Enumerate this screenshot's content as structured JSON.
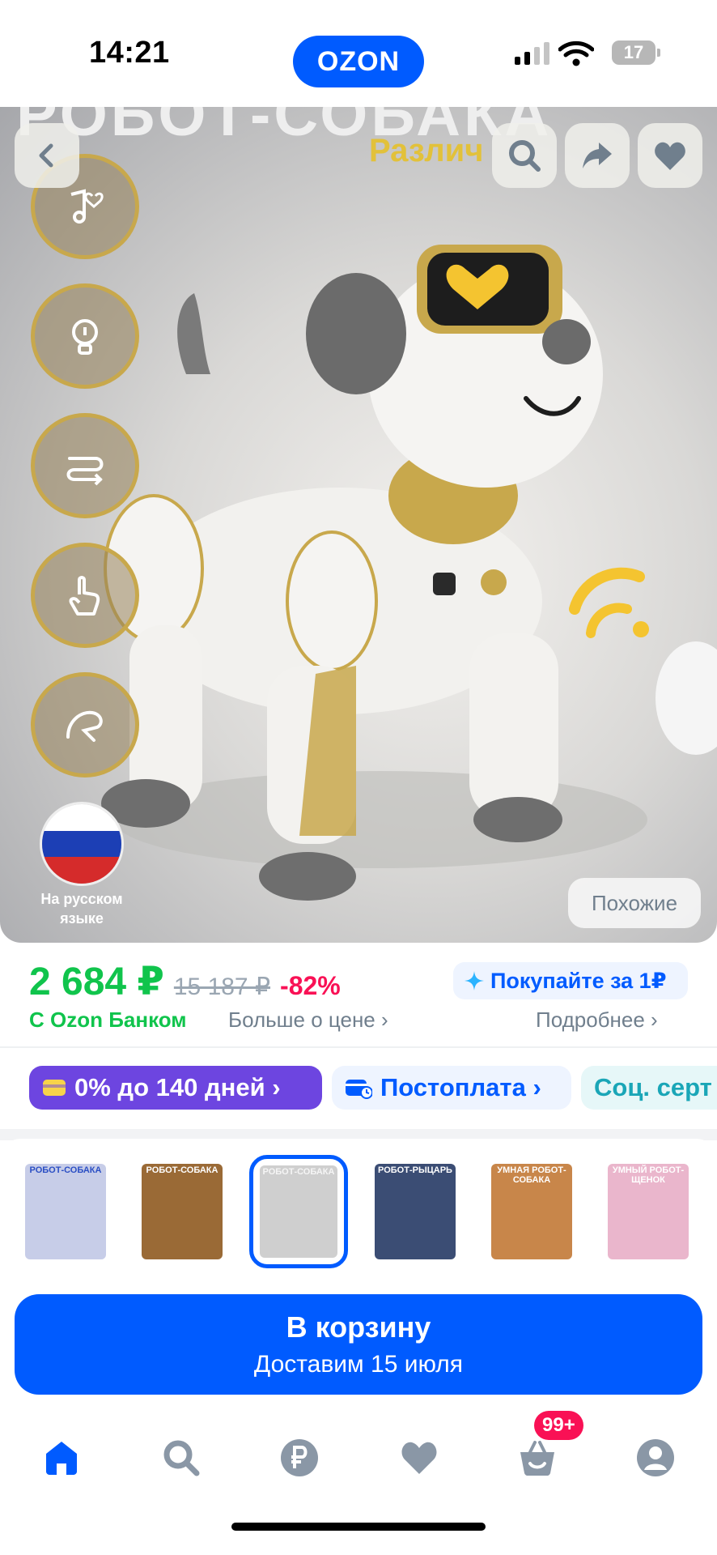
{
  "status_bar": {
    "time": "14:21",
    "battery": "17",
    "logo": "OZON"
  },
  "hero": {
    "banner_text": "РОБОТ-СОБАКА",
    "banner_sub": "Различ",
    "feature_icons": [
      "music-heart-icon",
      "lightbulb-icon",
      "route-icon",
      "touch-hand-icon",
      "handstand-icon"
    ],
    "flag_label": "На русском языке",
    "similar_label": "Похожие"
  },
  "price": {
    "current": "2 684 ₽",
    "old": "15 187 ₽",
    "discount": "-82%",
    "promo": "Покупайте за 1₽",
    "bank": "С Ozon Банком",
    "more_price": "Больше о цене ›",
    "details": "Подробнее ›"
  },
  "chips": [
    {
      "label": "0% до 140 дней ›",
      "icon": "card-icon"
    },
    {
      "label": "Постоплата ›",
      "icon": "wallet-clock-icon"
    },
    {
      "label": "Соц. серт",
      "icon": ""
    }
  ],
  "thumbnails": [
    {
      "caption": "РОБОТ-СОБАКА",
      "color": "#c7cde8"
    },
    {
      "caption": "РОБОТ-СОБАКА",
      "color": "#9a6a36"
    },
    {
      "caption": "РОБОТ-СОБАКА",
      "color": "#cfcfcf"
    },
    {
      "caption": "РОБОТ-РЫЦАРЬ",
      "color": "#3b4d74"
    },
    {
      "caption": "УМНАЯ РОБОТ-СОБАКА",
      "color": "#c8864a"
    },
    {
      "caption": "УМНЫЙ РОБОТ-ЩЕНОК",
      "color": "#eab6cc"
    }
  ],
  "cart": {
    "title": "В корзину",
    "subtitle": "Доставим 15 июля"
  },
  "nav": {
    "cart_badge": "99+"
  },
  "colors": {
    "accent": "#005bff",
    "price_green": "#10c44c",
    "discount_pink": "#f91155",
    "chip_purple": "#6d45e0"
  }
}
